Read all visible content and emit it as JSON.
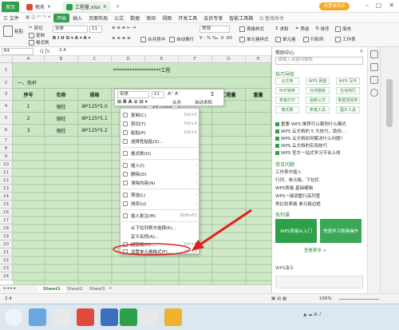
{
  "tabs": {
    "home": "首页",
    "doc": "税务",
    "file": "工程量.xlsx"
  },
  "user_button": "待登录同步",
  "menu": {
    "file": "三 文件",
    "items": [
      "开始",
      "插入",
      "页面布局",
      "公式",
      "数据",
      "审阅",
      "视图",
      "开发工具",
      "会员专享",
      "智能工具箱"
    ],
    "search": "Q 查找命令"
  },
  "ribbon": {
    "cut": "剪切",
    "copy": "复制",
    "format_painter": "格式刷",
    "paste": "粘贴",
    "font": "宋体",
    "size": "11",
    "merge": "合并居中",
    "wrap": "自动换行",
    "num_format": "常规",
    "cond": "条件格式",
    "cell_style": "单元格样式",
    "table_style": "表格样式",
    "sum": "求和",
    "filter": "筛选",
    "sort": "排序",
    "fill": "填充",
    "single_cell": "单元格",
    "row_col": "行和列",
    "sheet": "工作表"
  },
  "formula": {
    "cell_ref": "E4",
    "value": "2.4"
  },
  "columns": [
    "A",
    "B",
    "C",
    "D",
    "E",
    "F",
    "G",
    "H"
  ],
  "rows": [
    "1",
    "2",
    "3",
    "4",
    "5",
    "6",
    "7",
    "8",
    "9",
    "10",
    "11",
    "12",
    "13",
    "14",
    "15",
    "16",
    "17",
    "18",
    "19",
    "20",
    "21",
    "22",
    "23",
    "24"
  ],
  "sheet": {
    "title": "********************工程",
    "section": "一、热杆",
    "headers": [
      "序号",
      "名称",
      "规格",
      "单位",
      "数量",
      "单重",
      "工程量",
      "重量"
    ],
    "data": [
      {
        "no": "1",
        "name": "钢柱",
        "spec": "I8*125*5.0",
        "qty": "14.7069"
      },
      {
        "no": "2",
        "name": "钢柱",
        "spec": "I8*125*5.1",
        "qty": ""
      },
      {
        "no": "3",
        "name": "钢柱",
        "spec": "I8*125*5.2",
        "qty": ""
      }
    ]
  },
  "minitoolbar": {
    "font": "宋体",
    "size": "11",
    "merge": "合并",
    "autosum": "自动求和"
  },
  "context_menu": [
    {
      "label": "复制(C)",
      "shortcut": "Ctrl+C"
    },
    {
      "label": "剪切(T)",
      "shortcut": "Ctrl+X"
    },
    {
      "label": "粘贴(P)",
      "shortcut": "Ctrl+V"
    },
    {
      "label": "选择性粘贴(S)...",
      "shortcut": ""
    },
    {
      "label": "格式刷(O)",
      "shortcut": ""
    },
    {
      "label": "插入(I)",
      "shortcut": ""
    },
    {
      "label": "删除(D)",
      "shortcut": ""
    },
    {
      "label": "清除内容(N)",
      "shortcut": ""
    },
    {
      "label": "筛选(L)",
      "shortcut": ""
    },
    {
      "label": "排序(U)",
      "shortcut": ""
    },
    {
      "label": "插入批注(M)",
      "shortcut": "Shift+F2"
    },
    {
      "label": "从下拉列表中选择(K)...",
      "shortcut": ""
    },
    {
      "label": "定义名称(A)...",
      "shortcut": ""
    },
    {
      "label": "超链接(H)...",
      "shortcut": "Ctrl+K"
    },
    {
      "label": "设置单元格格式(F)...",
      "shortcut": "Ctrl+1"
    }
  ],
  "sheet_tabs": [
    "Sheet1",
    "Sheet2",
    "Sheet3"
  ],
  "status": {
    "cell": "2.4",
    "zoom": "100%"
  },
  "help": {
    "title": "帮助中心",
    "search": "请输入关键词搜索",
    "nav_title": "技巧导航",
    "nav": [
      "云文档",
      "WPS 网盘",
      "WPS 写作",
      "PDF转换",
      "在线模板",
      "在线简历",
      "表格打印",
      "函数公式",
      "数据透视表",
      "格式刷",
      "表格工具",
      "图片工具"
    ],
    "news": [
      "重要 WPS 推荐可以案例什么模式",
      "WPS 云文档的 5 大技巧，助你...",
      "WPS 云文档如何解决什么问题?",
      "WPS 云文档的实用技巧",
      "WPS 官方一站式学习平台上线"
    ],
    "faq_title": "常见问题",
    "faq": [
      "工作表中插入",
      "行列、单元格、下拉栏",
      "WPS表格 基础编辑",
      "WPS一键调整行高列宽",
      "再比较表格 单元格边框"
    ],
    "course_title": "系列课",
    "courses": [
      "WPS表格从入门",
      "快速学习表格操作"
    ],
    "more": "查看更多 >",
    "footer": "WPS演示"
  }
}
